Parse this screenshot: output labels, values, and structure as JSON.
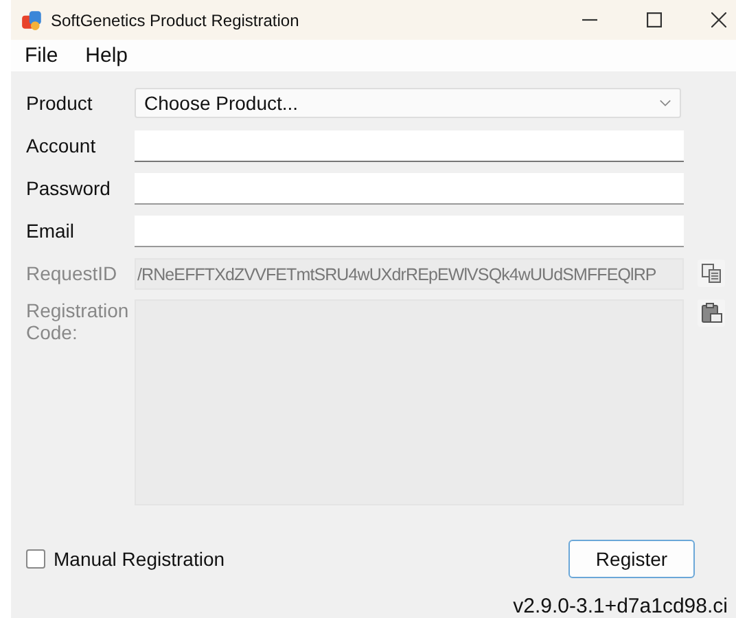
{
  "window": {
    "title": "SoftGenetics Product Registration"
  },
  "menu": [
    "File",
    "Help"
  ],
  "form": {
    "product": {
      "label": "Product",
      "value": "Choose Product..."
    },
    "fields": [
      {
        "label": "Account"
      },
      {
        "label": "Password"
      },
      {
        "label": "Email"
      }
    ],
    "request_id": {
      "label": "RequestID",
      "value": "/RNeEFFTXdZVVFETmtSRU4wUXdrREpEWlVSQk4wUUdSMFFEQlRP",
      "disabled": true
    },
    "registration_code": {
      "label": "Registration Code:",
      "disabled": true
    }
  },
  "manual_registration": {
    "label": "Manual Registration",
    "checked": false
  },
  "buttons": [
    "Register"
  ],
  "status_bar": {
    "version": "v2.9.0-3.1+d7a1cd98.ci"
  }
}
